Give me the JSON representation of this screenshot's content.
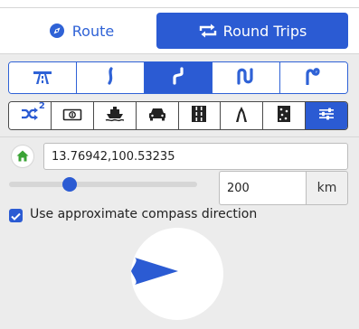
{
  "mode_tabs": {
    "route_label": "Route",
    "round_trips_label": "Round Trips",
    "active": "round_trips"
  },
  "road_curviness_options": [
    {
      "icon": "highway-icon",
      "active": false
    },
    {
      "icon": "slight-curve-icon",
      "active": false
    },
    {
      "icon": "curvy-road-icon",
      "active": true
    },
    {
      "icon": "very-curvy-road-icon",
      "active": false
    },
    {
      "icon": "extreme-curvy-road-icon",
      "active": false
    }
  ],
  "route_options": [
    {
      "icon": "shuffle-icon",
      "badge": "2",
      "active": false
    },
    {
      "icon": "toll-money-icon",
      "active": false
    },
    {
      "icon": "ferry-icon",
      "active": false
    },
    {
      "icon": "car-icon",
      "active": false
    },
    {
      "icon": "highway-road-icon",
      "active": false
    },
    {
      "icon": "narrow-road-icon",
      "active": false
    },
    {
      "icon": "unpaved-icon",
      "active": false
    },
    {
      "icon": "sliders-icon",
      "active": true
    }
  ],
  "start_point": {
    "value": "13.76942,100.53235"
  },
  "distance": {
    "value": "200",
    "unit": "km",
    "slider_fraction": 0.32
  },
  "compass_option": {
    "label": "Use approximate compass direction",
    "checked": true,
    "direction": "east"
  },
  "colors": {
    "accent": "#2b5bd3",
    "home_green": "#3aa335"
  }
}
